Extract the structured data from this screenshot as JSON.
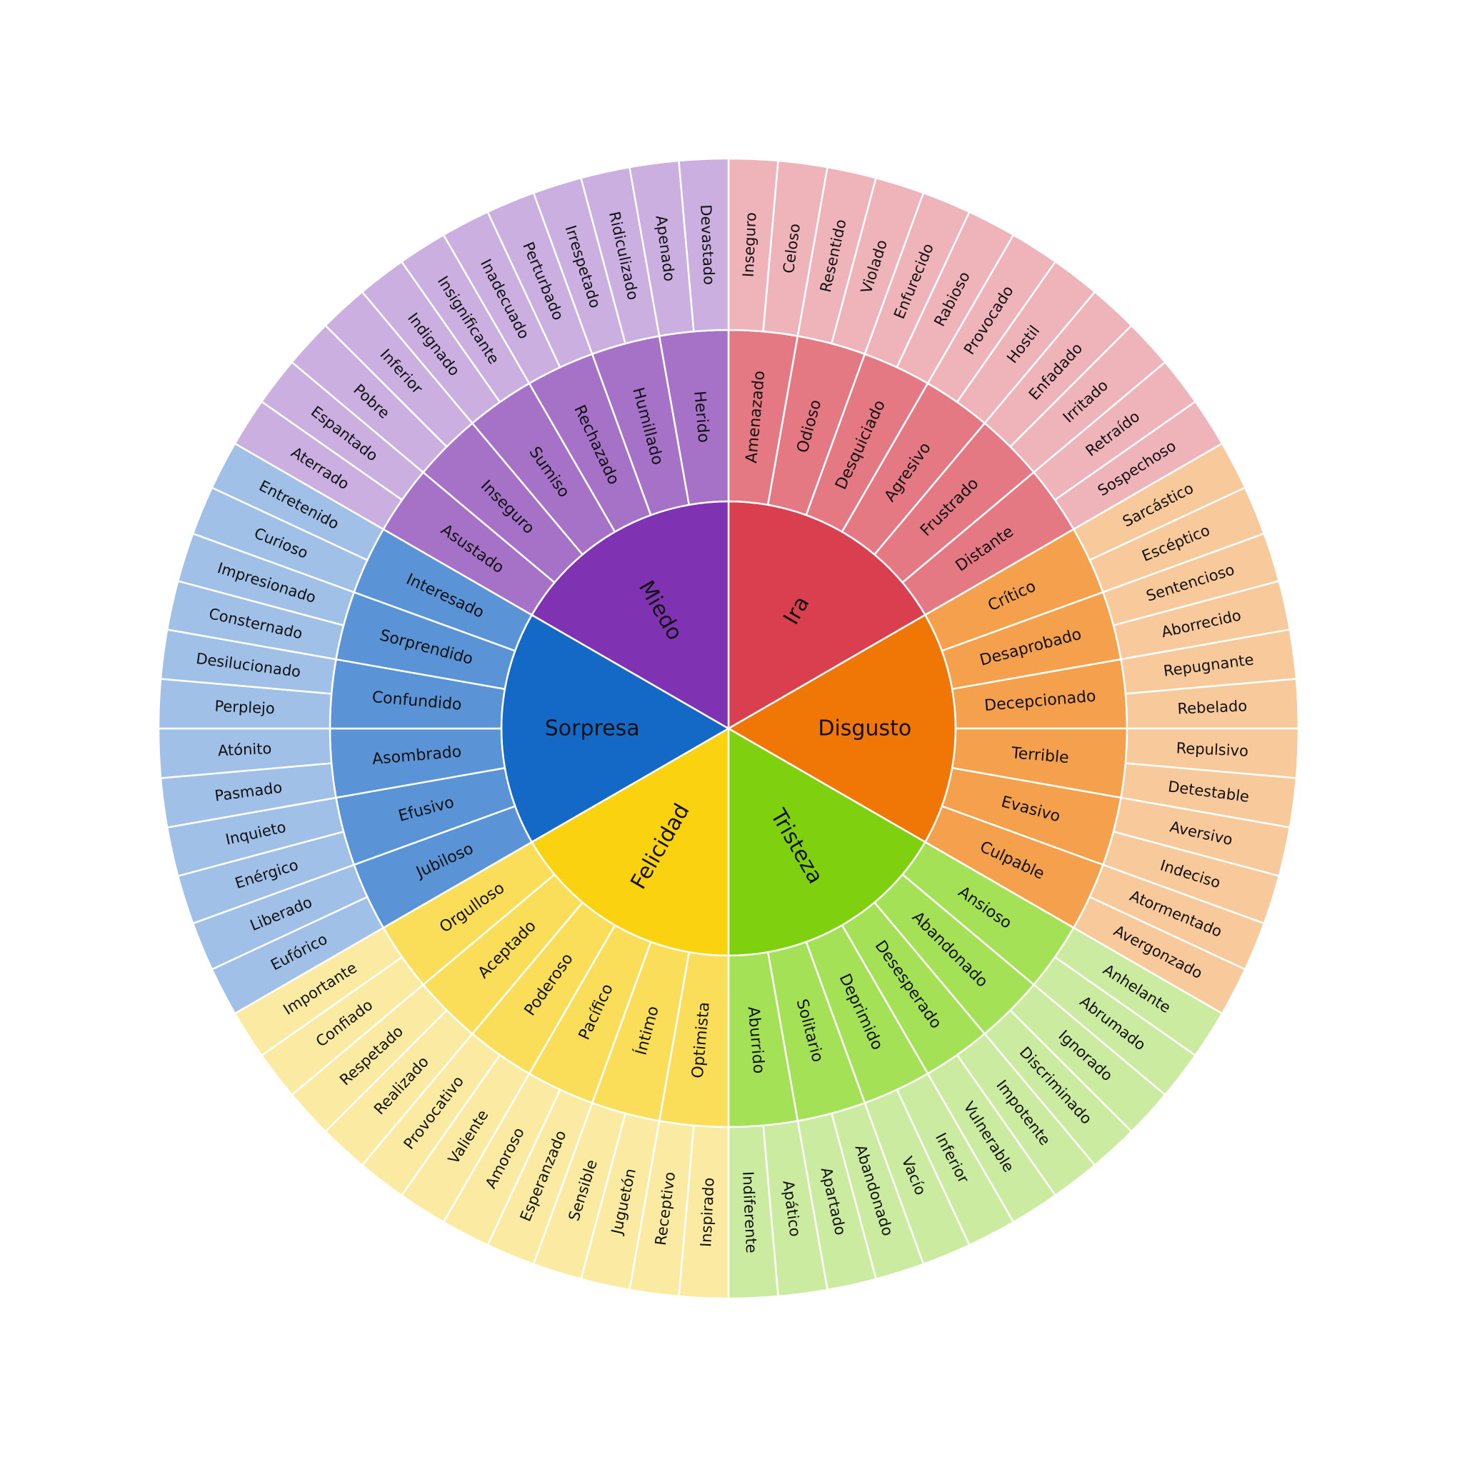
{
  "wheel": {
    "emotions": [
      {
        "name": "Ira",
        "colors": {
          "core": "#d93f4f",
          "mid": "#e57983",
          "outer": "#efb3ba"
        },
        "children": [
          {
            "name": "Amenazado",
            "children": [
              "Inseguro",
              "Celoso"
            ]
          },
          {
            "name": "Odioso",
            "children": [
              "Resentido",
              "Violado"
            ]
          },
          {
            "name": "Desquiciado",
            "children": [
              "Enfurecido",
              "Rabioso"
            ]
          },
          {
            "name": "Agresivo",
            "children": [
              "Provocado",
              "Hostil"
            ]
          },
          {
            "name": "Frustrado",
            "children": [
              "Enfadado",
              "Irritado"
            ]
          },
          {
            "name": "Distante",
            "children": [
              "Retraído",
              "Sospechoso"
            ]
          }
        ]
      },
      {
        "name": "Disgusto",
        "colors": {
          "core": "#f07605",
          "mid": "#f5a04d",
          "outer": "#f8c99b"
        },
        "children": [
          {
            "name": "Crítico",
            "children": [
              "Sarcástico",
              "Escéptico"
            ]
          },
          {
            "name": "Desaprobado",
            "children": [
              "Sentencioso",
              "Aborrecido"
            ]
          },
          {
            "name": "Decepcionado",
            "children": [
              "Repugnante",
              "Rebelado"
            ]
          },
          {
            "name": "Terrible",
            "children": [
              "Repulsivo",
              "Detestable"
            ]
          },
          {
            "name": "Evasivo",
            "children": [
              "Aversivo",
              "Indeciso"
            ]
          },
          {
            "name": "Culpable",
            "children": [
              "Atormentado",
              "Avergonzado"
            ]
          }
        ]
      },
      {
        "name": "Tristeza",
        "colors": {
          "core": "#7fd10f",
          "mid": "#a5e157",
          "outer": "#cbeba0"
        },
        "children": [
          {
            "name": "Ansioso",
            "children": [
              "Anhelante",
              "Abrumado"
            ]
          },
          {
            "name": "Abandonado",
            "children": [
              "Ignorado",
              "Discriminado"
            ]
          },
          {
            "name": "Desesperado",
            "children": [
              "Impotente",
              "Vulnerable"
            ]
          },
          {
            "name": "Deprimido",
            "children": [
              "Inferior",
              "Vacío"
            ]
          },
          {
            "name": "Solitario",
            "children": [
              "Abandonado",
              "Apartado"
            ]
          },
          {
            "name": "Aburrido",
            "children": [
              "Apático",
              "Indiferente"
            ]
          }
        ]
      },
      {
        "name": "Felicidad",
        "colors": {
          "core": "#fad20f",
          "mid": "#fade5a",
          "outer": "#fbeba2"
        },
        "children": [
          {
            "name": "Optimista",
            "children": [
              "Inspirado",
              "Receptivo"
            ]
          },
          {
            "name": "Íntimo",
            "children": [
              "Juguetón",
              "Sensible"
            ]
          },
          {
            "name": "Pacífico",
            "children": [
              "Esperanzado",
              "Amoroso"
            ]
          },
          {
            "name": "Poderoso",
            "children": [
              "Valiente",
              "Provocativo"
            ]
          },
          {
            "name": "Aceptado",
            "children": [
              "Realizado",
              "Respetado"
            ]
          },
          {
            "name": "Orgulloso",
            "children": [
              "Confiado",
              "Importante"
            ]
          }
        ]
      },
      {
        "name": "Sorpresa",
        "colors": {
          "core": "#1469c7",
          "mid": "#5a94d7",
          "outer": "#a0c0e8"
        },
        "children": [
          {
            "name": "Jubiloso",
            "children": [
              "Eufórico",
              "Liberado"
            ]
          },
          {
            "name": "Efusivo",
            "children": [
              "Enérgico",
              "Inquieto"
            ]
          },
          {
            "name": "Asombrado",
            "children": [
              "Pasmado",
              "Atónito"
            ]
          },
          {
            "name": "Confundido",
            "children": [
              "Perplejo",
              "Desilucionado"
            ]
          },
          {
            "name": "Sorprendido",
            "children": [
              "Consternado",
              "Impresionado"
            ]
          },
          {
            "name": "Interesado",
            "children": [
              "Curioso",
              "Entretenido"
            ]
          }
        ]
      },
      {
        "name": "Miedo",
        "colors": {
          "core": "#7f33b3",
          "mid": "#a572c8",
          "outer": "#cbafe0"
        },
        "children": [
          {
            "name": "Asustado",
            "children": [
              "Aterrado",
              "Espantado"
            ]
          },
          {
            "name": "Inseguro",
            "children": [
              "Pobre",
              "Inferior"
            ]
          },
          {
            "name": "Sumiso",
            "children": [
              "Indignado",
              "Insignificante"
            ]
          },
          {
            "name": "Rechazado",
            "children": [
              "Inadecuado",
              "Perturbado"
            ]
          },
          {
            "name": "Humillado",
            "children": [
              "Irrespetado",
              "Ridiculizado"
            ]
          },
          {
            "name": "Herido",
            "children": [
              "Apenado",
              "Devastado"
            ]
          }
        ]
      }
    ]
  }
}
